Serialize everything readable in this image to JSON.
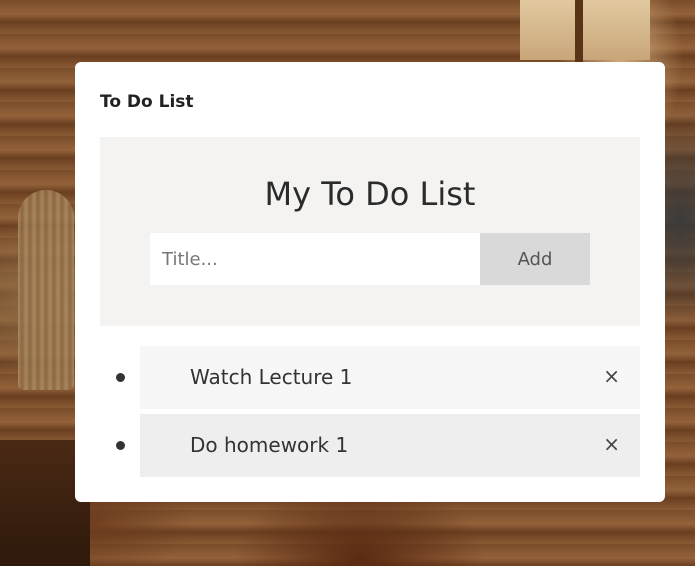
{
  "card": {
    "title": "To Do List"
  },
  "header": {
    "heading": "My To Do List",
    "input_placeholder": "Title...",
    "add_label": "Add"
  },
  "todos": [
    {
      "text": "Watch Lecture 1",
      "close_icon": "×"
    },
    {
      "text": "Do homework 1",
      "close_icon": "×"
    }
  ]
}
